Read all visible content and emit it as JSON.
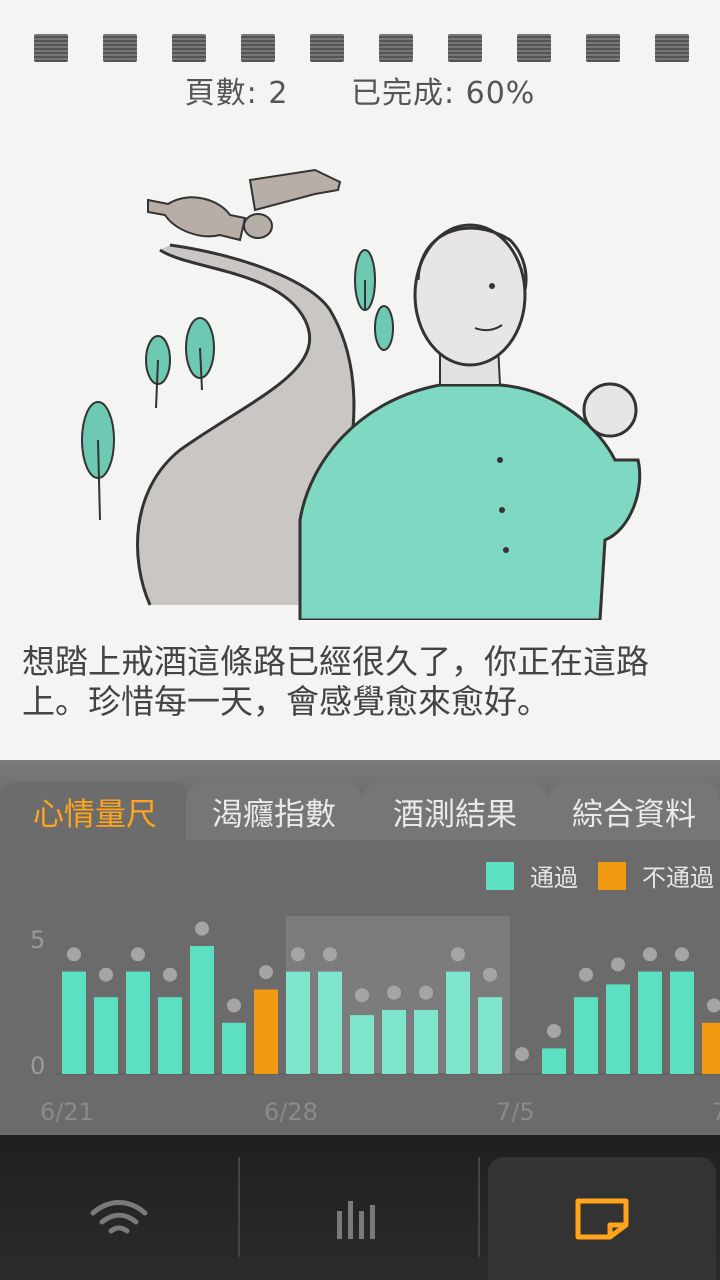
{
  "card": {
    "page_label": "頁數: 2",
    "completed_label": "已完成: 60%",
    "quote": "想踏上戒酒這條路已經很久了，你正在這路上。珍惜每一天，會感覺愈來愈好。"
  },
  "tabs": [
    {
      "label": "心情量尺",
      "active": true
    },
    {
      "label": "渴癮指數",
      "active": false
    },
    {
      "label": "酒測結果",
      "active": false
    },
    {
      "label": "綜合資料",
      "active": false
    }
  ],
  "legend": {
    "pass_label": "通過",
    "fail_label": "不通過",
    "pass_color": "#5ddfc1",
    "fail_color": "#f29a0f"
  },
  "chart_data": {
    "type": "bar",
    "ylim": [
      0,
      5
    ],
    "y_ticks": [
      "0",
      "5"
    ],
    "x_ticks": [
      "6/21",
      "6/28",
      "7/5",
      "7"
    ],
    "bars": [
      4,
      3,
      4,
      3,
      5,
      2,
      3.3,
      4,
      4,
      2.3,
      2.5,
      2.5,
      4,
      3,
      0,
      1,
      3,
      3.5,
      4,
      4,
      2
    ],
    "dots": [
      4.6,
      3.8,
      4.6,
      3.8,
      5.6,
      2.6,
      3.9,
      4.6,
      4.6,
      3.0,
      3.1,
      3.1,
      4.6,
      3.8,
      0.7,
      1.6,
      3.8,
      4.2,
      4.6,
      4.6,
      2.6
    ],
    "status": [
      "pass",
      "pass",
      "pass",
      "pass",
      "pass",
      "pass",
      "fail",
      "pass",
      "pass",
      "pass",
      "pass",
      "pass",
      "pass",
      "pass",
      "pass",
      "pass",
      "pass",
      "pass",
      "pass",
      "pass",
      "fail"
    ]
  },
  "nav": {
    "items": [
      {
        "icon": "wifi-icon"
      },
      {
        "icon": "bars-icon"
      },
      {
        "icon": "note-icon",
        "active": true
      }
    ],
    "active_color": "#ffa41c"
  }
}
